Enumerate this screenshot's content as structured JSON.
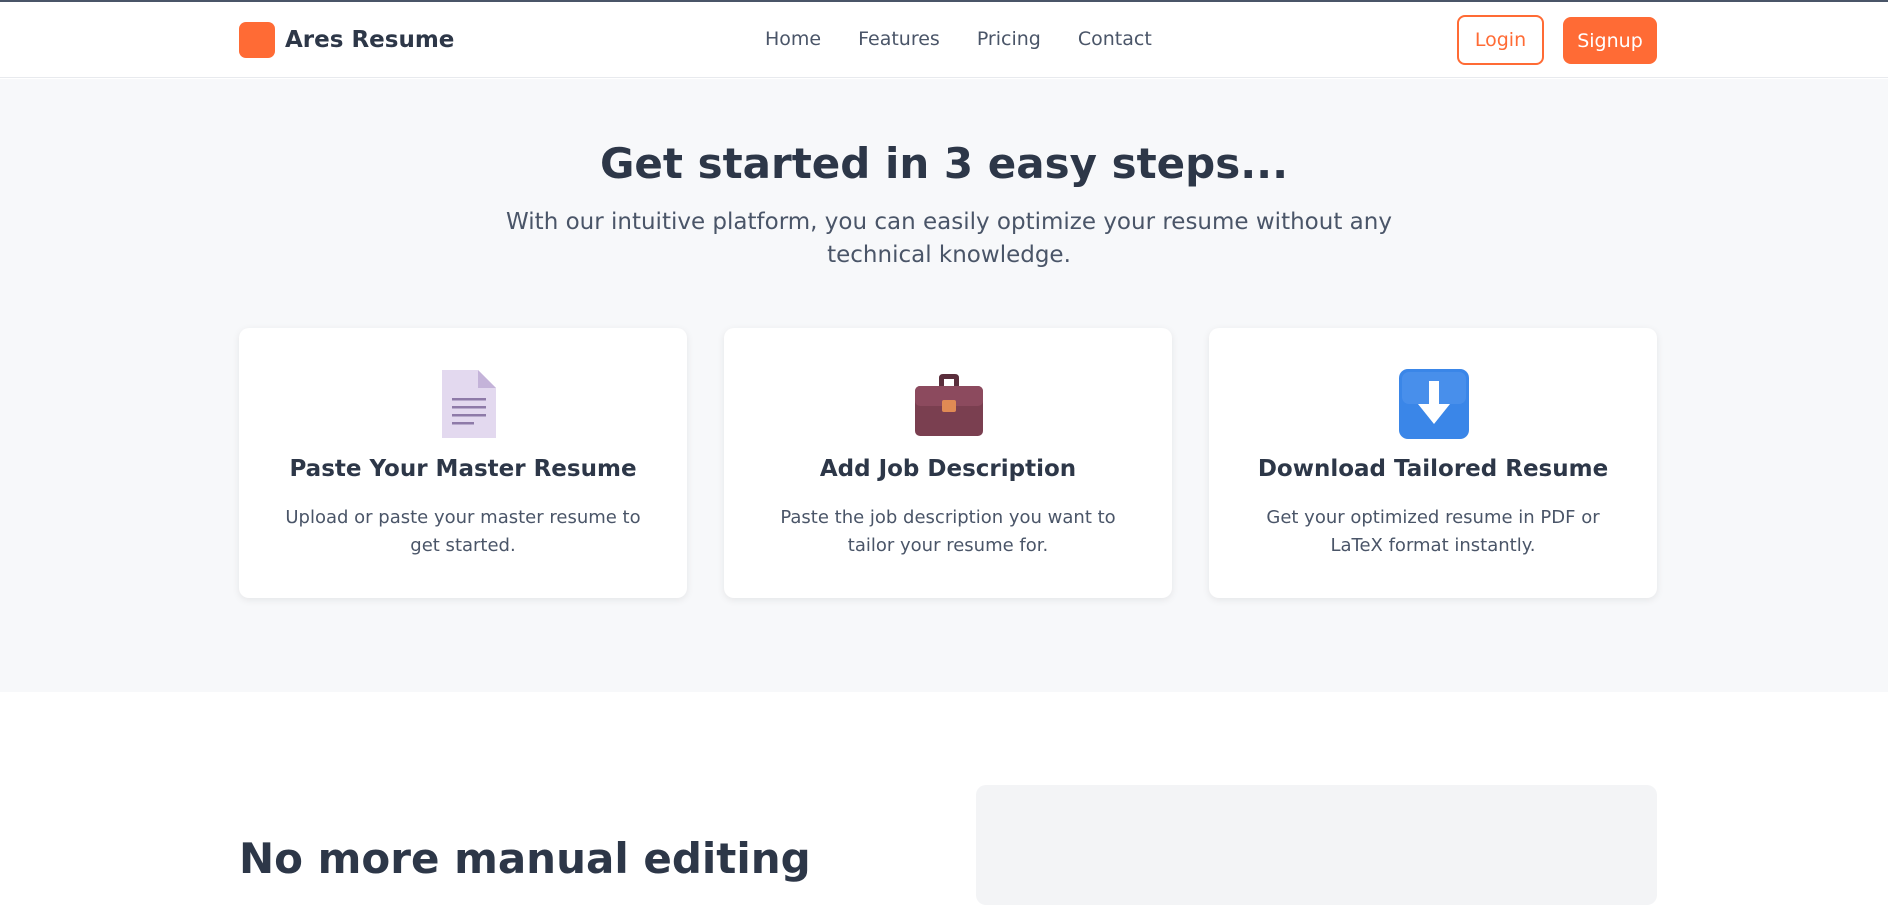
{
  "brand": {
    "name": "Ares Resume",
    "accent_color": "#ff6b35"
  },
  "nav": {
    "links": [
      {
        "label": "Home"
      },
      {
        "label": "Features"
      },
      {
        "label": "Pricing"
      },
      {
        "label": "Contact"
      }
    ],
    "login_label": "Login",
    "signup_label": "Signup"
  },
  "steps": {
    "title": "Get started in 3 easy steps...",
    "subtitle": "With our intuitive platform, you can easily optimize your resume without any technical knowledge.",
    "cards": [
      {
        "icon": "document-icon",
        "title": "Paste Your Master Resume",
        "description": "Upload or paste your master resume to get started."
      },
      {
        "icon": "briefcase-icon",
        "title": "Add Job Description",
        "description": "Paste the job description you want to tailor your resume for."
      },
      {
        "icon": "download-arrow-icon",
        "title": "Download Tailored Resume",
        "description": "Get your optimized resume in PDF or LaTeX format instantly."
      }
    ]
  },
  "feature": {
    "heading": "No more manual editing"
  }
}
